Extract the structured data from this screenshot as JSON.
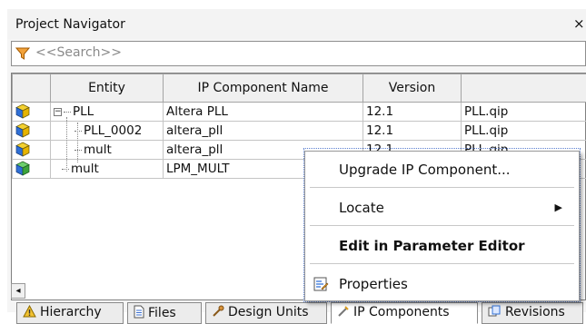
{
  "panel": {
    "title": "Project Navigator",
    "close_glyph": "×"
  },
  "search": {
    "placeholder": "<<Search>>",
    "icon": "funnel-icon"
  },
  "table": {
    "columns": [
      "",
      "Entity",
      "IP Component Name",
      "Version",
      ""
    ],
    "rows": [
      {
        "icon": "ip-component-icon",
        "entity": "PLL",
        "component": "Altera PLL",
        "version": "12.1",
        "file": "PLL.qip",
        "expander": "−"
      },
      {
        "icon": "ip-component-icon",
        "entity": "PLL_0002",
        "component": "altera_pll",
        "version": "12.1",
        "file": "PLL.qip"
      },
      {
        "icon": "ip-component-icon",
        "entity": "mult",
        "component": "altera_pll",
        "version": "12.1",
        "file": "PLL.qip"
      },
      {
        "icon": "ip-component-green-icon",
        "entity": "mult",
        "component": "LPM_MULT",
        "version": "",
        "file": ""
      }
    ]
  },
  "scroll": {
    "left_glyph": "◂"
  },
  "tabs": [
    {
      "label": "Hierarchy",
      "icon": "hierarchy-warning-icon"
    },
    {
      "label": "Files",
      "icon": "file-icon"
    },
    {
      "label": "Design Units",
      "icon": "design-units-icon"
    },
    {
      "label": "IP Components",
      "icon": "ip-components-icon"
    },
    {
      "label": "Revisions",
      "icon": "revisions-icon"
    }
  ],
  "context_menu": {
    "items": [
      {
        "label": "Upgrade IP Component..."
      },
      {
        "label": "Locate",
        "submenu_glyph": "▶"
      },
      {
        "label": "Edit in Parameter Editor"
      },
      {
        "label": "Properties",
        "icon": "properties-icon"
      }
    ]
  },
  "colors": {
    "accent_blue": "#2f6fd6",
    "cube_yellow": "#e6b400",
    "cube_green": "#3ba33b"
  }
}
